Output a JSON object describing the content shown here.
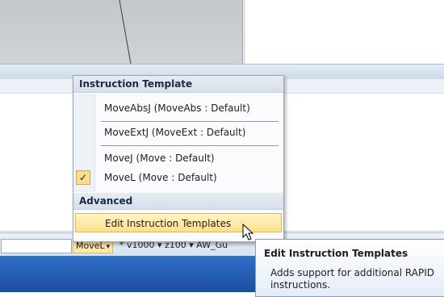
{
  "menu": {
    "section_template": "Instruction Template",
    "items": [
      {
        "label": "MoveAbsJ (MoveAbs : Default)",
        "checked": false
      },
      {
        "label": "MoveExtJ (MoveExt : Default)",
        "checked": false
      },
      {
        "label": "MoveJ (Move : Default)",
        "checked": false
      },
      {
        "label": "MoveL (Move : Default)",
        "checked": true
      }
    ],
    "section_advanced": "Advanced",
    "edit_templates": "Edit Instruction Templates",
    "check_glyph": "✓"
  },
  "statusbar": {
    "instruction": "MoveL",
    "rest": "* v1000 ▾ z100 ▾ AW_Gu"
  },
  "tooltip": {
    "title": "Edit Instruction Templates",
    "body": "Adds support for additional RAPID instructions."
  },
  "colors": {
    "highlight": "#ffe08a",
    "taskbar": "#1c4fa0",
    "ribbon": "#cddbec"
  }
}
